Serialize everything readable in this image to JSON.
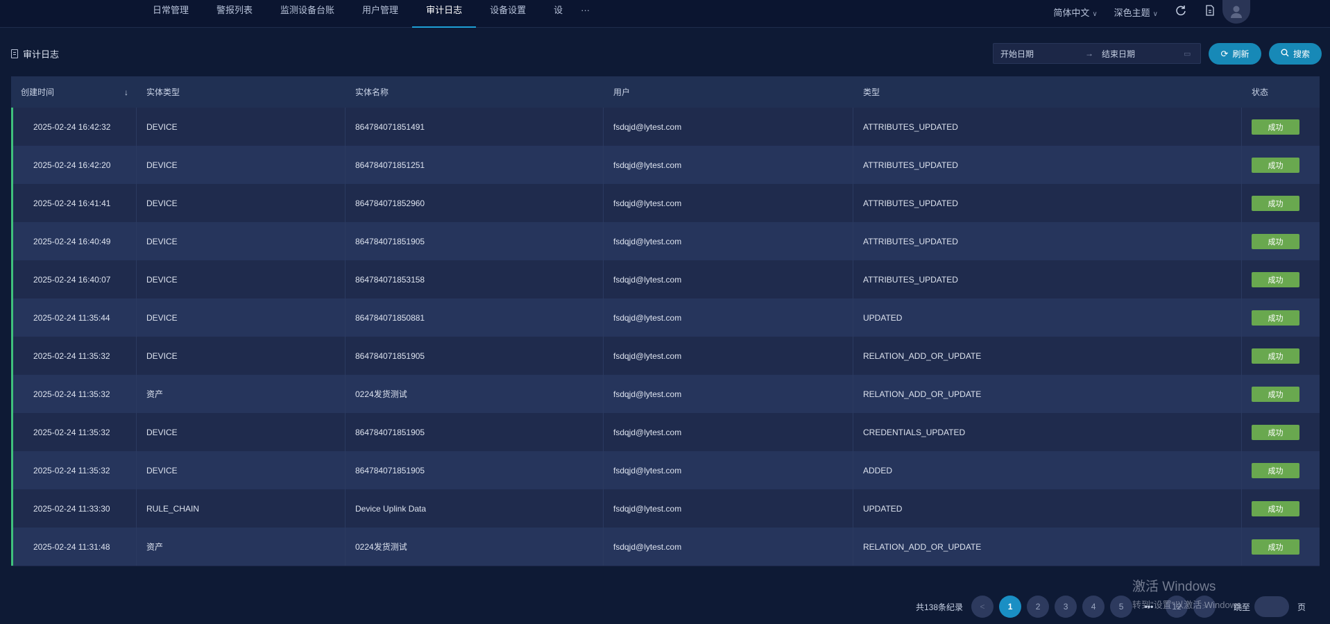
{
  "nav": {
    "tabs": [
      {
        "label": "日常管理",
        "active": false
      },
      {
        "label": "警报列表",
        "active": false
      },
      {
        "label": "监测设备台账",
        "active": false
      },
      {
        "label": "用户管理",
        "active": false
      },
      {
        "label": "审计日志",
        "active": true
      },
      {
        "label": "设备设置",
        "active": false
      },
      {
        "label": "设",
        "active": false
      }
    ],
    "more": "···",
    "language": "简体中文",
    "theme": "深色主题",
    "icons": [
      "refresh-icon",
      "document-icon",
      "fullscreen-icon",
      "user-icon"
    ]
  },
  "toolbar": {
    "page_title": "审计日志",
    "start_placeholder": "开始日期",
    "end_placeholder": "结束日期",
    "range_arrow": "→",
    "refresh_label": "刷新",
    "search_label": "搜索"
  },
  "table": {
    "columns": [
      "创建时间",
      "实体类型",
      "实体名称",
      "用户",
      "类型",
      "状态"
    ],
    "sort_icon": "↓",
    "rows": [
      {
        "time": "2025-02-24 16:42:32",
        "entity_type": "DEVICE",
        "entity_name": "864784071851491",
        "user": "fsdqjd@lytest.com",
        "type": "ATTRIBUTES_UPDATED",
        "status": "成功"
      },
      {
        "time": "2025-02-24 16:42:20",
        "entity_type": "DEVICE",
        "entity_name": "864784071851251",
        "user": "fsdqjd@lytest.com",
        "type": "ATTRIBUTES_UPDATED",
        "status": "成功"
      },
      {
        "time": "2025-02-24 16:41:41",
        "entity_type": "DEVICE",
        "entity_name": "864784071852960",
        "user": "fsdqjd@lytest.com",
        "type": "ATTRIBUTES_UPDATED",
        "status": "成功"
      },
      {
        "time": "2025-02-24 16:40:49",
        "entity_type": "DEVICE",
        "entity_name": "864784071851905",
        "user": "fsdqjd@lytest.com",
        "type": "ATTRIBUTES_UPDATED",
        "status": "成功"
      },
      {
        "time": "2025-02-24 16:40:07",
        "entity_type": "DEVICE",
        "entity_name": "864784071853158",
        "user": "fsdqjd@lytest.com",
        "type": "ATTRIBUTES_UPDATED",
        "status": "成功"
      },
      {
        "time": "2025-02-24 11:35:44",
        "entity_type": "DEVICE",
        "entity_name": "864784071850881",
        "user": "fsdqjd@lytest.com",
        "type": "UPDATED",
        "status": "成功"
      },
      {
        "time": "2025-02-24 11:35:32",
        "entity_type": "DEVICE",
        "entity_name": "864784071851905",
        "user": "fsdqjd@lytest.com",
        "type": "RELATION_ADD_OR_UPDATE",
        "status": "成功"
      },
      {
        "time": "2025-02-24 11:35:32",
        "entity_type": "资产",
        "entity_name": "0224发货测试",
        "user": "fsdqjd@lytest.com",
        "type": "RELATION_ADD_OR_UPDATE",
        "status": "成功"
      },
      {
        "time": "2025-02-24 11:35:32",
        "entity_type": "DEVICE",
        "entity_name": "864784071851905",
        "user": "fsdqjd@lytest.com",
        "type": "CREDENTIALS_UPDATED",
        "status": "成功"
      },
      {
        "time": "2025-02-24 11:35:32",
        "entity_type": "DEVICE",
        "entity_name": "864784071851905",
        "user": "fsdqjd@lytest.com",
        "type": "ADDED",
        "status": "成功"
      },
      {
        "time": "2025-02-24 11:33:30",
        "entity_type": "RULE_CHAIN",
        "entity_name": "Device Uplink Data",
        "user": "fsdqjd@lytest.com",
        "type": "UPDATED",
        "status": "成功"
      },
      {
        "time": "2025-02-24 11:31:48",
        "entity_type": "资产",
        "entity_name": "0224发货测试",
        "user": "fsdqjd@lytest.com",
        "type": "RELATION_ADD_OR_UPDATE",
        "status": "成功"
      }
    ]
  },
  "pagination": {
    "total_label": "共138条纪录",
    "prev": "<",
    "pages": [
      "1",
      "2",
      "3",
      "4",
      "5"
    ],
    "current": "1",
    "ellipsis": "•••",
    "last": "12",
    "next": ">",
    "jump_label": "跳至",
    "page_unit": "页"
  },
  "watermark": {
    "line1": "激活 Windows",
    "line2": "转到\"设置\"以激活 Windows。"
  },
  "colors": {
    "background": "#0e1a35",
    "accent": "#1789b7",
    "success_badge": "#69a84f",
    "row_indicator": "#3fc17c"
  }
}
